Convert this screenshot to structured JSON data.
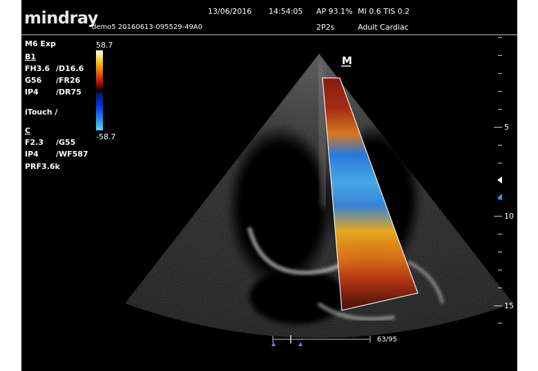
{
  "header": {
    "brand": "mindray",
    "patient_id": "demo5 20160613-095529-49A0",
    "date": "13/06/2016",
    "time": "14:54:05",
    "ap": "AP 93.1%",
    "mi_tis": "MI 0.6  TIS 0.2",
    "probe": "2P2s",
    "preset": "Adult Cardiac"
  },
  "left_panel": {
    "mode": "M6 Exp",
    "b_label": "B1",
    "b_params": [
      {
        "a": "FH3.6",
        "b": "/D16.6"
      },
      {
        "a": "G56",
        "b": "/FR26"
      },
      {
        "a": "IP4",
        "b": "/DR75"
      }
    ],
    "itouch": "iTouch  /",
    "c_label": "C",
    "c_params": [
      {
        "a": "F2.3",
        "b": "/G55"
      },
      {
        "a": "IP4",
        "b": "/WF587"
      }
    ],
    "prf": "PRF3.6k"
  },
  "color_scale": {
    "top": "58.7",
    "bottom": "-58.7",
    "colors": [
      "#ffffff",
      "#ffae00",
      "#e03000",
      "#000000",
      "#0030e0",
      "#60d8ff"
    ]
  },
  "orientation_marker": "M",
  "depth_scale": {
    "labels": [
      "5",
      "10",
      "15"
    ],
    "marker_icons": [
      "focus-marker-icon",
      "color-box-marker-icon"
    ]
  },
  "cine": {
    "frame": "63/95"
  }
}
